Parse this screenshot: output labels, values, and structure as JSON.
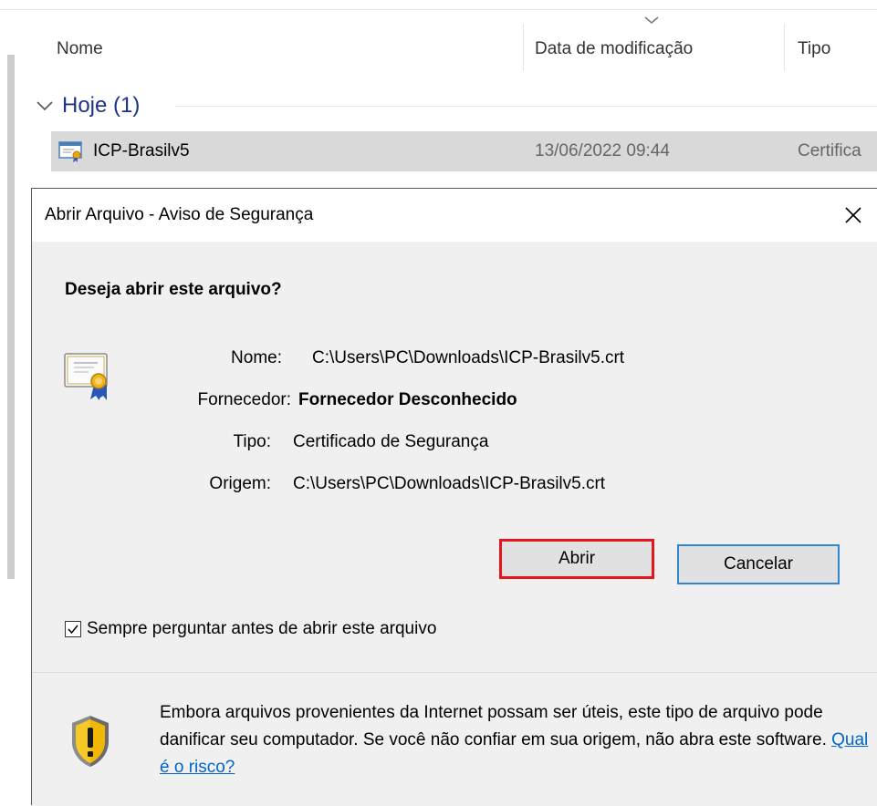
{
  "explorer": {
    "columns": {
      "name": "Nome",
      "date": "Data de modificação",
      "type": "Tipo"
    },
    "group": {
      "label": "Hoje (1)"
    },
    "file": {
      "name": "ICP-Brasilv5",
      "date": "13/06/2022 09:44",
      "type": "Certifica"
    }
  },
  "dialog": {
    "title": "Abrir Arquivo - Aviso de Segurança",
    "question": "Deseja abrir este arquivo?",
    "fields": {
      "name_label": "Nome:",
      "name_value": "C:\\Users\\PC\\Downloads\\ICP-Brasilv5.crt",
      "publisher_label": "Fornecedor:",
      "publisher_value": "Fornecedor Desconhecido",
      "type_label": "Tipo:",
      "type_value": "Certificado de Segurança",
      "origin_label": "Origem:",
      "origin_value": "C:\\Users\\PC\\Downloads\\ICP-Brasilv5.crt"
    },
    "buttons": {
      "open": "Abrir",
      "cancel": "Cancelar"
    },
    "checkbox": {
      "label": "Sempre perguntar antes de abrir este arquivo",
      "checked": true
    },
    "warning": {
      "text": "Embora arquivos provenientes da Internet possam ser úteis, este tipo de arquivo pode danificar seu computador. Se você não confiar em sua origem, não abra este software.",
      "link": "Qual é o risco?"
    }
  },
  "colors": {
    "group_label": "#1e3287",
    "open_highlight": "#e5141d",
    "cancel_focus": "#2f86d6",
    "link": "#0066cc"
  }
}
